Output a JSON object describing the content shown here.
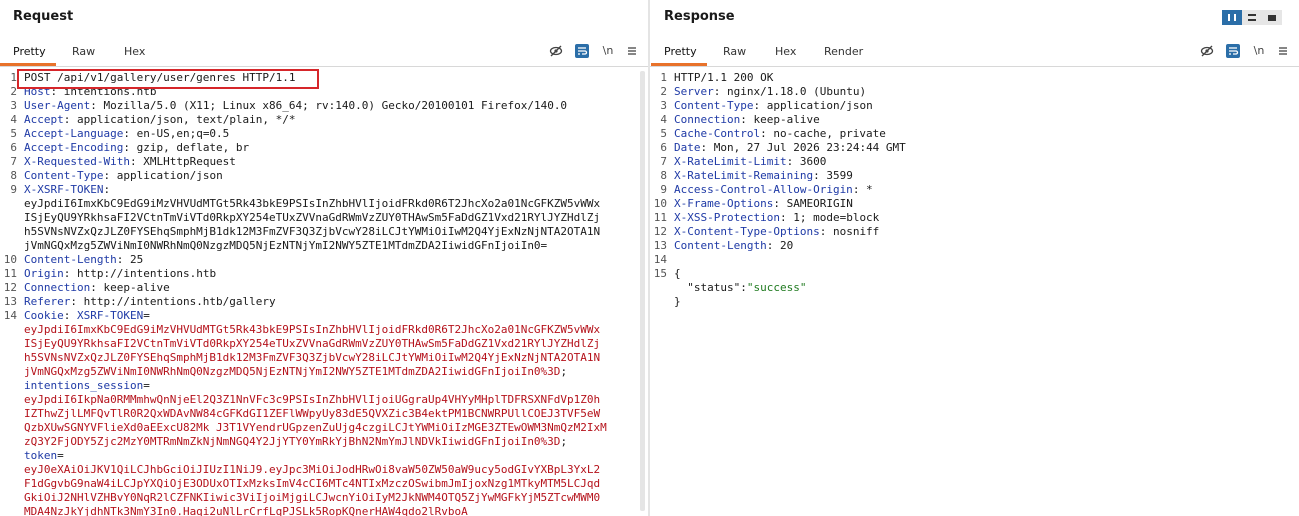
{
  "request": {
    "title": "Request",
    "tabs": [
      "Pretty",
      "Raw",
      "Hex"
    ],
    "icons": {
      "hide": "eye-slash-icon",
      "wrap": "wrap-lines-icon",
      "newline": "\\n",
      "menu": "hamburger-menu-icon"
    },
    "lines": [
      {
        "n": "1",
        "t": [
          {
            "c": "kv",
            "v": "POST /api/v1/gallery/user/genres HTTP/1.1"
          }
        ]
      },
      {
        "n": "2",
        "t": [
          {
            "c": "k",
            "v": "Host"
          },
          {
            "c": "kv",
            "v": ": intentions.htb"
          }
        ]
      },
      {
        "n": "3",
        "t": [
          {
            "c": "k",
            "v": "User-Agent"
          },
          {
            "c": "kv",
            "v": ": Mozilla/5.0 (X11; Linux x86_64; rv:140.0) Gecko/20100101 Firefox/140.0"
          }
        ]
      },
      {
        "n": "4",
        "t": [
          {
            "c": "k",
            "v": "Accept"
          },
          {
            "c": "kv",
            "v": ": application/json, text/plain, */*"
          }
        ]
      },
      {
        "n": "5",
        "t": [
          {
            "c": "k",
            "v": "Accept-Language"
          },
          {
            "c": "kv",
            "v": ": en-US,en;q=0.5"
          }
        ]
      },
      {
        "n": "6",
        "t": [
          {
            "c": "k",
            "v": "Accept-Encoding"
          },
          {
            "c": "kv",
            "v": ": gzip, deflate, br"
          }
        ]
      },
      {
        "n": "7",
        "t": [
          {
            "c": "k",
            "v": "X-Requested-With"
          },
          {
            "c": "kv",
            "v": ": XMLHttpRequest"
          }
        ]
      },
      {
        "n": "8",
        "t": [
          {
            "c": "k",
            "v": "Content-Type"
          },
          {
            "c": "kv",
            "v": ": application/json"
          }
        ]
      },
      {
        "n": "9",
        "t": [
          {
            "c": "k",
            "v": "X-XSRF-TOKEN"
          },
          {
            "c": "kv",
            "v": ":"
          }
        ]
      },
      {
        "n": "",
        "t": [
          {
            "c": "kv",
            "v": "eyJpdiI6ImxKbC9EdG9iMzVHVUdMTGt5Rk43bkE9PSIsInZhbHVlIjoidFRkd0R6T2JhcXo2a01NcGFKZW5vWWx"
          }
        ]
      },
      {
        "n": "",
        "t": [
          {
            "c": "kv",
            "v": "ISjEyQU9YRkhsaFI2VCtnTmViVTd0RkpXY254eTUxZVVnaGdRWmVzZUY0THAwSm5FaDdGZ1Vxd21RYlJYZHdlZj"
          }
        ]
      },
      {
        "n": "",
        "t": [
          {
            "c": "kv",
            "v": "h5SVNsNVZxQzJLZ0FYSEhqSmphMjB1dk12M3FmZVF3Q3ZjbVcwY28iLCJtYWMiOiIwM2Q4YjExNzNjNTA2OTA1N"
          }
        ]
      },
      {
        "n": "",
        "t": [
          {
            "c": "kv",
            "v": "jVmNGQxMzg5ZWViNmI0NWRhNmQ0NzgzMDQ5NjEzNTNjYmI2NWY5ZTE1MTdmZDA2IiwidGFnIjoiIn0="
          }
        ]
      },
      {
        "n": "10",
        "t": [
          {
            "c": "k",
            "v": "Content-Length"
          },
          {
            "c": "kv",
            "v": ": 25"
          }
        ]
      },
      {
        "n": "11",
        "t": [
          {
            "c": "k",
            "v": "Origin"
          },
          {
            "c": "kv",
            "v": ": http://intentions.htb"
          }
        ]
      },
      {
        "n": "12",
        "t": [
          {
            "c": "k",
            "v": "Connection"
          },
          {
            "c": "kv",
            "v": ": keep-alive"
          }
        ]
      },
      {
        "n": "13",
        "t": [
          {
            "c": "k",
            "v": "Referer"
          },
          {
            "c": "kv",
            "v": ": http://intentions.htb/gallery"
          }
        ]
      },
      {
        "n": "14",
        "t": [
          {
            "c": "k",
            "v": "Cookie"
          },
          {
            "c": "kv",
            "v": ": "
          },
          {
            "c": "k",
            "v": "XSRF-TOKEN"
          },
          {
            "c": "kv",
            "v": "="
          }
        ]
      },
      {
        "n": "",
        "t": [
          {
            "c": "r",
            "v": "eyJpdiI6ImxKbC9EdG9iMzVHVUdMTGt5Rk43bkE9PSIsInZhbHVlIjoidFRkd0R6T2JhcXo2a01NcGFKZW5vWWx"
          }
        ]
      },
      {
        "n": "",
        "t": [
          {
            "c": "r",
            "v": "ISjEyQU9YRkhsaFI2VCtnTmViVTd0RkpXY254eTUxZVVnaGdRWmVzZUY0THAwSm5FaDdGZ1Vxd21RYlJYZHdlZj"
          }
        ]
      },
      {
        "n": "",
        "t": [
          {
            "c": "r",
            "v": "h5SVNsNVZxQzJLZ0FYSEhqSmphMjB1dk12M3FmZVF3Q3ZjbVcwY28iLCJtYWMiOiIwM2Q4YjExNzNjNTA2OTA1N"
          }
        ]
      },
      {
        "n": "",
        "t": [
          {
            "c": "r",
            "v": "jVmNGQxMzg5ZWViNmI0NWRhNmQ0NzgzMDQ5NjEzNTNjYmI2NWY5ZTE1MTdmZDA2IiwidGFnIjoiIn0%3D"
          },
          {
            "c": "kv",
            "v": ";"
          }
        ]
      },
      {
        "n": "",
        "t": [
          {
            "c": "k",
            "v": "intentions_session"
          },
          {
            "c": "kv",
            "v": "="
          }
        ]
      },
      {
        "n": "",
        "t": [
          {
            "c": "r",
            "v": "eyJpdiI6IkpNa0RMMmhwQnNjeEl2Q3Z1NnVFc3c9PSIsInZhbHVlIjoiUGgraUp4VHYyMHplTDFRSXNFdVp1Z0h"
          }
        ]
      },
      {
        "n": "",
        "t": [
          {
            "c": "r",
            "v": "IZThwZjlLMFQvTlR0R2QxWDAvNW84cGFKdGI1ZEFlWWpyUy83dE5QVXZic3B4ektPM1BCNWRPUllCOEJ3TVF5eW"
          }
        ]
      },
      {
        "n": "",
        "t": [
          {
            "c": "r",
            "v": "QzbXUwSGNYVFlieXd0aEExcU82Mk J3T1VYendrUGpzenZuUjg4czgiLCJtYWMiOiIzMGE3ZTEwOWM3NmQzM2IxM"
          }
        ]
      },
      {
        "n": "",
        "t": [
          {
            "c": "r",
            "v": "zQ3Y2FjODY5Zjc2MzY0MTRmNmZkNjNmNGQ4Y2JjYTY0YmRkYjBhN2NmYmJlNDVkIiwidGFnIjoiIn0%3D"
          },
          {
            "c": "kv",
            "v": ";"
          }
        ]
      },
      {
        "n": "",
        "t": [
          {
            "c": "k",
            "v": "token"
          },
          {
            "c": "kv",
            "v": "="
          }
        ]
      },
      {
        "n": "",
        "t": [
          {
            "c": "r",
            "v": "eyJ0eXAiOiJKV1QiLCJhbGciOiJIUzI1NiJ9.eyJpc3MiOiJodHRwOi8vaW50ZW50aW9ucy5odGIvYXBpL3YxL2"
          }
        ]
      },
      {
        "n": "",
        "t": [
          {
            "c": "r",
            "v": "F1dGgvbG9naW4iLCJpYXQiOjE3ODUxOTIxMzksImV4cCI6MTc4NTIxMzczOSwibmJmIjoxNzg1MTkyMTM5LCJqd"
          }
        ]
      },
      {
        "n": "",
        "t": [
          {
            "c": "r",
            "v": "GkiOiJ2NHlVZHBvY0NqR2lCZFNKIiwic3ViIjoiMjgiLCJwcnYiOiIyM2JkNWM4OTQ5ZjYwMGFkYjM5ZTcwMWM0"
          }
        ]
      },
      {
        "n": "",
        "t": [
          {
            "c": "r",
            "v": "MDA4NzJkYjdhNTk3NmY3In0.Haqi2uNlLrCrfLqPJSLk5RopKQnerHAW4qdo2lRvboA"
          }
        ]
      }
    ]
  },
  "response": {
    "title": "Response",
    "tabs": [
      "Pretty",
      "Raw",
      "Hex",
      "Render"
    ],
    "icons": {
      "hide": "eye-slash-icon",
      "wrap": "wrap-lines-icon",
      "newline": "\\n",
      "menu": "hamburger-menu-icon"
    },
    "lines": [
      {
        "n": "1",
        "t": [
          {
            "c": "kv",
            "v": "HTTP/1.1 200 OK"
          }
        ]
      },
      {
        "n": "2",
        "t": [
          {
            "c": "k",
            "v": "Server"
          },
          {
            "c": "kv",
            "v": ": nginx/1.18.0 (Ubuntu)"
          }
        ]
      },
      {
        "n": "3",
        "t": [
          {
            "c": "k",
            "v": "Content-Type"
          },
          {
            "c": "kv",
            "v": ": application/json"
          }
        ]
      },
      {
        "n": "4",
        "t": [
          {
            "c": "k",
            "v": "Connection"
          },
          {
            "c": "kv",
            "v": ": keep-alive"
          }
        ]
      },
      {
        "n": "5",
        "t": [
          {
            "c": "k",
            "v": "Cache-Control"
          },
          {
            "c": "kv",
            "v": ": no-cache, private"
          }
        ]
      },
      {
        "n": "6",
        "t": [
          {
            "c": "k",
            "v": "Date"
          },
          {
            "c": "kv",
            "v": ": Mon, 27 Jul 2026 23:24:44 GMT"
          }
        ]
      },
      {
        "n": "7",
        "t": [
          {
            "c": "k",
            "v": "X-RateLimit-Limit"
          },
          {
            "c": "kv",
            "v": ": 3600"
          }
        ]
      },
      {
        "n": "8",
        "t": [
          {
            "c": "k",
            "v": "X-RateLimit-Remaining"
          },
          {
            "c": "kv",
            "v": ": 3599"
          }
        ]
      },
      {
        "n": "9",
        "t": [
          {
            "c": "k",
            "v": "Access-Control-Allow-Origin"
          },
          {
            "c": "kv",
            "v": ": *"
          }
        ]
      },
      {
        "n": "10",
        "t": [
          {
            "c": "k",
            "v": "X-Frame-Options"
          },
          {
            "c": "kv",
            "v": ": SAMEORIGIN"
          }
        ]
      },
      {
        "n": "11",
        "t": [
          {
            "c": "k",
            "v": "X-XSS-Protection"
          },
          {
            "c": "kv",
            "v": ": 1; mode=block"
          }
        ]
      },
      {
        "n": "12",
        "t": [
          {
            "c": "k",
            "v": "X-Content-Type-Options"
          },
          {
            "c": "kv",
            "v": ": nosniff"
          }
        ]
      },
      {
        "n": "13",
        "t": [
          {
            "c": "k",
            "v": "Content-Length"
          },
          {
            "c": "kv",
            "v": ": 20"
          }
        ]
      },
      {
        "n": "14",
        "t": []
      },
      {
        "n": "15",
        "t": [
          {
            "c": "kv",
            "v": "{"
          }
        ]
      },
      {
        "n": "",
        "t": [
          {
            "c": "kv",
            "v": "  \""
          },
          {
            "c": "json-k",
            "v": "status"
          },
          {
            "c": "kv",
            "v": "\":"
          },
          {
            "c": "json-s",
            "v": "\"success\""
          }
        ]
      },
      {
        "n": "",
        "t": [
          {
            "c": "kv",
            "v": "}"
          }
        ]
      }
    ]
  },
  "colors": {
    "accent": "#e8722a",
    "highlight_box": "#d6262a",
    "header_name": "#1f3aa6",
    "cookie_value": "#b5121b",
    "active_icon": "#2b6ea8"
  }
}
